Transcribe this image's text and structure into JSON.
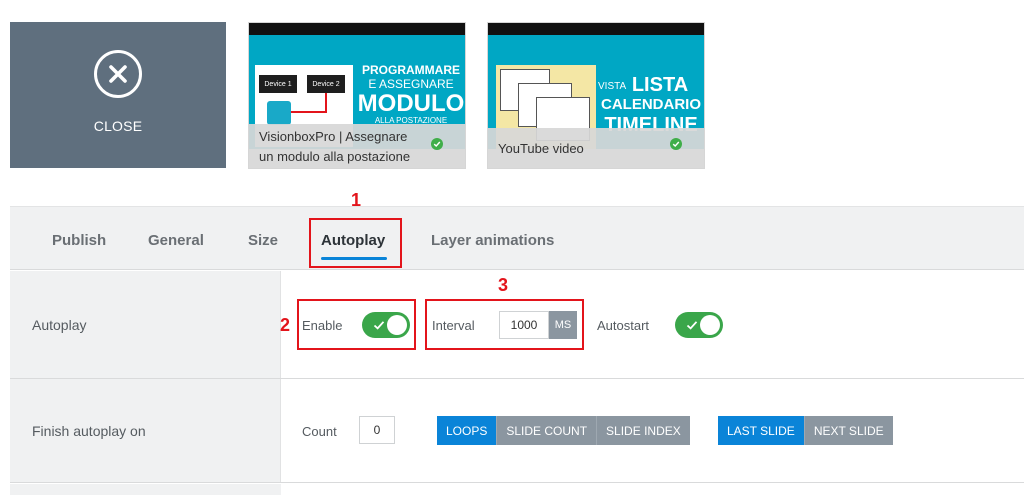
{
  "close": {
    "label": "CLOSE",
    "icon": "close-circle-icon"
  },
  "thumbnails": [
    {
      "art_lines": [
        "PROGRAMMARE",
        "E ASSEGNARE",
        "MODULO",
        "ALLA POSTAZIONE"
      ],
      "device_labels": [
        "Device 1",
        "Device 2"
      ],
      "caption": "VisionboxPro | Assegnare un modulo alla postazione",
      "status_icon": "check-circle-icon"
    },
    {
      "art_lines": [
        "VISTA",
        "LISTA",
        "CALENDARIO",
        "TIMELINE"
      ],
      "caption": "YouTube video",
      "status_icon": "check-circle-icon"
    }
  ],
  "tabs": [
    {
      "label": "Publish"
    },
    {
      "label": "General"
    },
    {
      "label": "Size"
    },
    {
      "label": "Autoplay",
      "active": true
    },
    {
      "label": "Layer animations"
    }
  ],
  "autoplay_row": {
    "label": "Autoplay",
    "enable_label": "Enable",
    "enable_on": true,
    "interval_label": "Interval",
    "interval_value": "1000",
    "interval_unit": "MS",
    "autostart_label": "Autostart",
    "autostart_on": true
  },
  "finish_row": {
    "label": "Finish autoplay on",
    "count_label": "Count",
    "count_value": "0",
    "group1": [
      "LOOPS",
      "SLIDE COUNT",
      "SLIDE INDEX"
    ],
    "group1_selected": "LOOPS",
    "group2": [
      "LAST SLIDE",
      "NEXT SLIDE"
    ],
    "group2_selected": "LAST SLIDE"
  },
  "annotations": {
    "m1": "1",
    "m2": "2",
    "m3": "3"
  },
  "colors": {
    "accent": "#0a84d8",
    "toggle_on": "#3aa64a",
    "highlight": "#e3141b",
    "thumb_bg": "#00a7c4"
  }
}
